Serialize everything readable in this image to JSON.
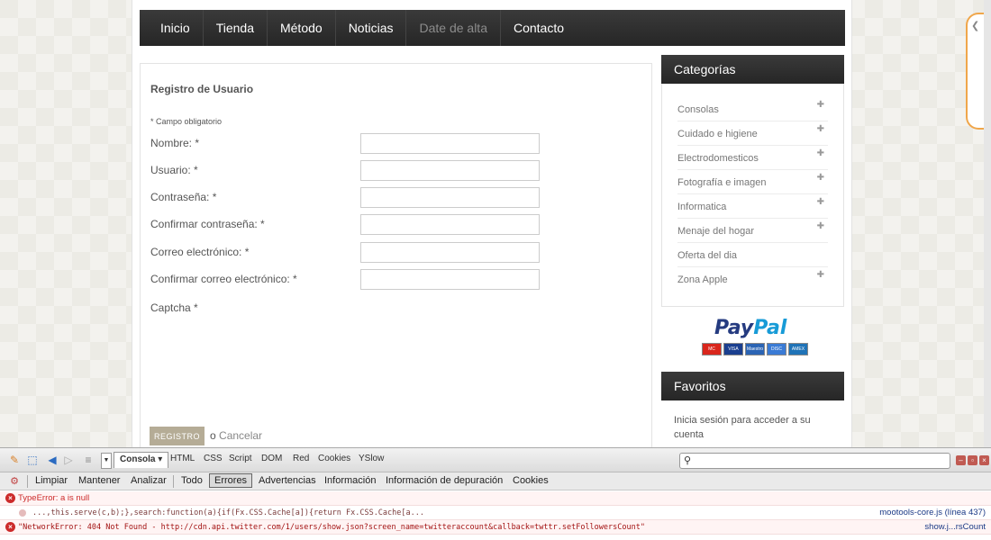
{
  "nav": [
    {
      "label": "Inicio",
      "dim": false
    },
    {
      "label": "Tienda",
      "dim": false
    },
    {
      "label": "Método",
      "dim": false
    },
    {
      "label": "Noticias",
      "dim": false
    },
    {
      "label": "Date de alta",
      "dim": true
    },
    {
      "label": "Contacto",
      "dim": false
    }
  ],
  "form": {
    "title": "Registro de Usuario",
    "required_note": "* Campo obligatorio",
    "fields": [
      {
        "label": "Nombre: *",
        "value": ""
      },
      {
        "label": "Usuario: *",
        "value": ""
      },
      {
        "label": "Contraseña: *",
        "value": ""
      },
      {
        "label": "Confirmar contraseña: *",
        "value": ""
      },
      {
        "label": "Correo electrónico: *",
        "value": ""
      },
      {
        "label": "Confirmar correo electrónico: *",
        "value": ""
      }
    ],
    "captcha_label": "Captcha *",
    "submit_label": "REGISTRO",
    "or_text": "o",
    "cancel_label": "Cancelar"
  },
  "sidebar": {
    "categories_title": "Categorías",
    "categories": [
      {
        "label": "Consolas",
        "expandable": true
      },
      {
        "label": "Cuidado e higiene",
        "expandable": true
      },
      {
        "label": "Electrodomesticos",
        "expandable": true
      },
      {
        "label": "Fotografía e imagen",
        "expandable": true
      },
      {
        "label": "Informatica",
        "expandable": true
      },
      {
        "label": "Menaje del hogar",
        "expandable": true
      },
      {
        "label": "Oferta del dia",
        "expandable": false
      },
      {
        "label": "Zona Apple",
        "expandable": true
      }
    ],
    "paypal_part1": "Pay",
    "paypal_part2": "Pal",
    "payment_cards": [
      "MC",
      "VISA",
      "Maestro",
      "DISC",
      "AMEX"
    ],
    "favorites_title": "Favoritos",
    "favorites_text": "Inicia sesión para acceder a su cuenta"
  },
  "firebug": {
    "panel_select": "Consola",
    "tabs": [
      "HTML",
      "CSS",
      "Script",
      "DOM",
      "Red",
      "Cookies",
      "YSlow"
    ],
    "search_placeholder": "",
    "toolbar": [
      "Limpiar",
      "Mantener",
      "Analizar",
      "Todo",
      "Errores",
      "Advertencias",
      "Información",
      "Información de depuración",
      "Cookies"
    ],
    "active_filter": "Errores",
    "errors": [
      {
        "message": "TypeError: a is null",
        "source": "mootools-core.js (línea 437)"
      },
      {
        "code": "...,this.serve(c,b);},search:function(a){if(Fx.CSS.Cache[a]){return Fx.CSS.Cache[a..."
      },
      {
        "message": "\"NetworkError: 404 Not Found - http://cdn.api.twitter.com/1/users/show.json?screen_name=twitteraccount&callback=twttr.setFollowersCount\"",
        "source": "show.j...rsCount"
      }
    ]
  }
}
